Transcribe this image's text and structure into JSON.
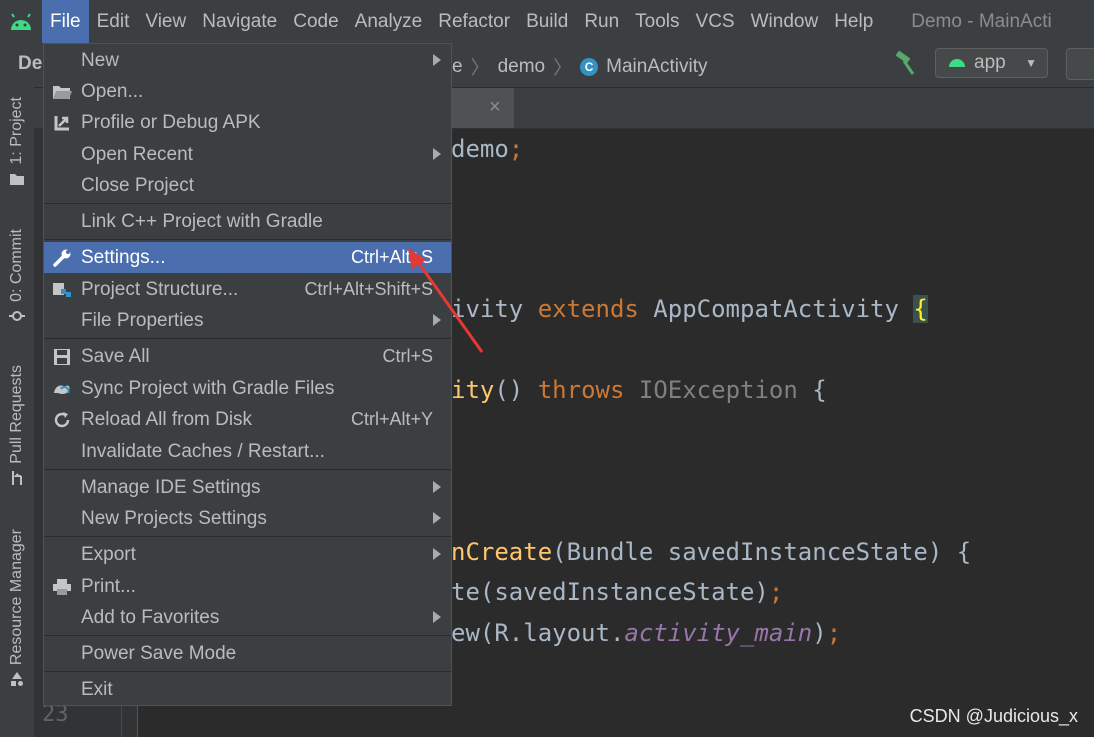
{
  "menubar": {
    "items": [
      "File",
      "Edit",
      "View",
      "Navigate",
      "Code",
      "Analyze",
      "Refactor",
      "Build",
      "Run",
      "Tools",
      "VCS",
      "Window",
      "Help"
    ],
    "window_title": "Demo - MainActi"
  },
  "navbar": {
    "root": "De",
    "crumbs": [
      "e",
      "demo",
      "MainActivity"
    ],
    "class_icon_letter": "C",
    "run_config": "app"
  },
  "toolstrip": {
    "tabs": [
      "1: Project",
      "0: Commit",
      "Pull Requests",
      "Resource Manager"
    ]
  },
  "editor": {
    "line_number": "23",
    "lines": [
      {
        "a": "demo",
        "b": ";"
      },
      {
        "a": "ivity ",
        "b": "extends",
        "c": " AppCompatActivity ",
        "d": "{"
      },
      {
        "a": "ity",
        "b": "() ",
        "c": "throws",
        "d": " IOException ",
        "e": "{"
      },
      {
        "a": "nCreate",
        "b": "(Bundle savedInstanceState) {"
      },
      {
        "a": "te(savedInstanceState)",
        "b": ";"
      },
      {
        "a": "ew(R.layout.",
        "b": "activity_main",
        "c": ")",
        "d": ";"
      }
    ],
    "tab_close": "×"
  },
  "file_menu": {
    "items": [
      {
        "label": "New",
        "shortcut": "",
        "submenu": true,
        "icon": "none"
      },
      {
        "label": "Open...",
        "shortcut": "",
        "submenu": false,
        "icon": "folder-icon"
      },
      {
        "label": "Profile or Debug APK",
        "shortcut": "",
        "submenu": false,
        "icon": "profile-apk-icon"
      },
      {
        "label": "Open Recent",
        "shortcut": "",
        "submenu": true,
        "icon": "none"
      },
      {
        "label": "Close Project",
        "shortcut": "",
        "submenu": false,
        "icon": "none"
      },
      {
        "label": "Link C++ Project with Gradle",
        "shortcut": "",
        "submenu": false,
        "icon": "none"
      },
      {
        "label": "Settings...",
        "shortcut": "Ctrl+Alt+S",
        "submenu": false,
        "icon": "wrench-icon",
        "selected": true
      },
      {
        "label": "Project Structure...",
        "shortcut": "Ctrl+Alt+Shift+S",
        "submenu": false,
        "icon": "project-structure-icon"
      },
      {
        "label": "File Properties",
        "shortcut": "",
        "submenu": true,
        "icon": "none"
      },
      {
        "label": "Save All",
        "shortcut": "Ctrl+S",
        "submenu": false,
        "icon": "save-icon"
      },
      {
        "label": "Sync Project with Gradle Files",
        "shortcut": "",
        "submenu": false,
        "icon": "gradle-sync-icon"
      },
      {
        "label": "Reload All from Disk",
        "shortcut": "Ctrl+Alt+Y",
        "submenu": false,
        "icon": "reload-icon"
      },
      {
        "label": "Invalidate Caches / Restart...",
        "shortcut": "",
        "submenu": false,
        "icon": "none"
      },
      {
        "label": "Manage IDE Settings",
        "shortcut": "",
        "submenu": true,
        "icon": "none"
      },
      {
        "label": "New Projects Settings",
        "shortcut": "",
        "submenu": true,
        "icon": "none"
      },
      {
        "label": "Export",
        "shortcut": "",
        "submenu": true,
        "icon": "none"
      },
      {
        "label": "Print...",
        "shortcut": "",
        "submenu": false,
        "icon": "print-icon"
      },
      {
        "label": "Add to Favorites",
        "shortcut": "",
        "submenu": true,
        "icon": "none"
      },
      {
        "label": "Power Save Mode",
        "shortcut": "",
        "submenu": false,
        "icon": "none"
      },
      {
        "label": "Exit",
        "shortcut": "",
        "submenu": false,
        "icon": "none"
      }
    ]
  },
  "colors": {
    "menu_selection": "#4b6eaf",
    "annotation_arrow": "#e53935",
    "keyword": "#cc7832"
  },
  "watermark": "CSDN @Judicious_x"
}
